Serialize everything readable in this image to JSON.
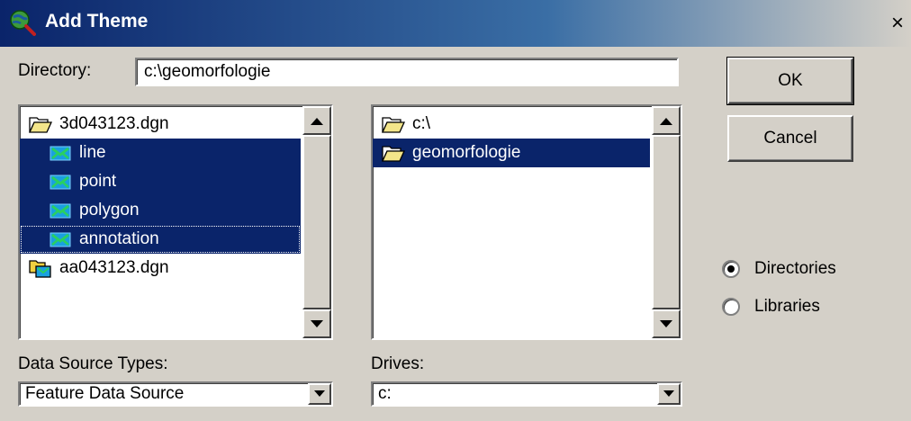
{
  "window": {
    "title": "Add Theme",
    "close_label": "×"
  },
  "directory": {
    "label": "Directory:",
    "value": "c:\\geomorfologie"
  },
  "buttons": {
    "ok": "OK",
    "cancel": "Cancel"
  },
  "themes_list": {
    "items": [
      {
        "label": "3d043123.dgn",
        "icon": "open-folder-icon",
        "selected": false
      },
      {
        "label": "line",
        "icon": "feature-class-icon",
        "selected": true
      },
      {
        "label": "point",
        "icon": "feature-class-icon",
        "selected": true
      },
      {
        "label": "polygon",
        "icon": "feature-class-icon",
        "selected": true
      },
      {
        "label": "annotation",
        "icon": "feature-class-icon",
        "selected": true,
        "focused": true
      },
      {
        "label": "aa043123.dgn",
        "icon": "dataset-folder-icon",
        "selected": false
      }
    ]
  },
  "folders_list": {
    "items": [
      {
        "label": "c:\\",
        "icon": "open-folder-icon",
        "selected": false
      },
      {
        "label": "geomorfologie",
        "icon": "open-folder-icon",
        "selected": true
      }
    ]
  },
  "data_source_types": {
    "label": "Data Source Types:",
    "value": "Feature Data Source"
  },
  "drives": {
    "label": "Drives:",
    "value": "c:"
  },
  "view_mode": {
    "options": [
      {
        "label": "Directories",
        "checked": true
      },
      {
        "label": "Libraries",
        "checked": false
      }
    ]
  },
  "colors": {
    "selection": "#0a246a",
    "face": "#d4d0c8"
  }
}
